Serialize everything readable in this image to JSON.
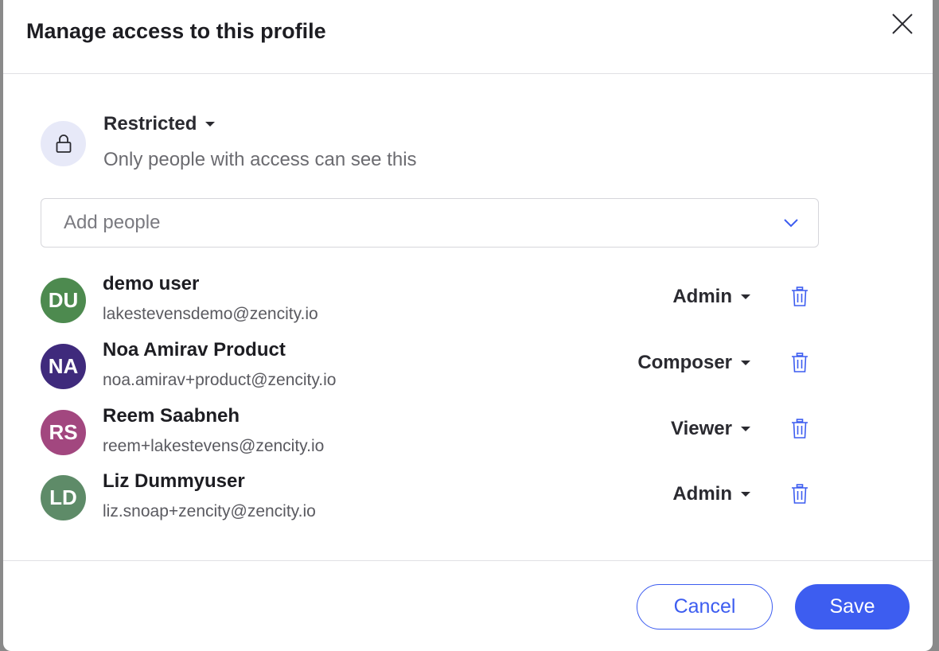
{
  "dialog": {
    "title": "Manage access to this profile"
  },
  "access": {
    "level": "Restricted",
    "description": "Only people with access can see this"
  },
  "add_people": {
    "placeholder": "Add people"
  },
  "people": [
    {
      "initials": "DU",
      "name": "demo user",
      "email": "lakestevensdemo@zencity.io",
      "role": "Admin",
      "avatar_color": "#4d8a4f"
    },
    {
      "initials": "NA",
      "name": "Noa Amirav Product",
      "email": "noa.amirav+product@zencity.io",
      "role": "Composer",
      "avatar_color": "#3f2a7c"
    },
    {
      "initials": "RS",
      "name": "Reem Saabneh",
      "email": "reem+lakestevens@zencity.io",
      "role": "Viewer",
      "avatar_color": "#a2477f"
    },
    {
      "initials": "LD",
      "name": "Liz Dummyuser",
      "email": "liz.snoap+zencity@zencity.io",
      "role": "Admin",
      "avatar_color": "#5e8b68"
    }
  ],
  "footer": {
    "cancel_label": "Cancel",
    "save_label": "Save"
  },
  "colors": {
    "accent": "#3d5df0",
    "lock_bg": "#e7e9f8"
  },
  "icons": {
    "close": "close-icon",
    "lock": "lock-icon",
    "chevron": "chevron-down-icon",
    "trash": "trash-icon"
  }
}
